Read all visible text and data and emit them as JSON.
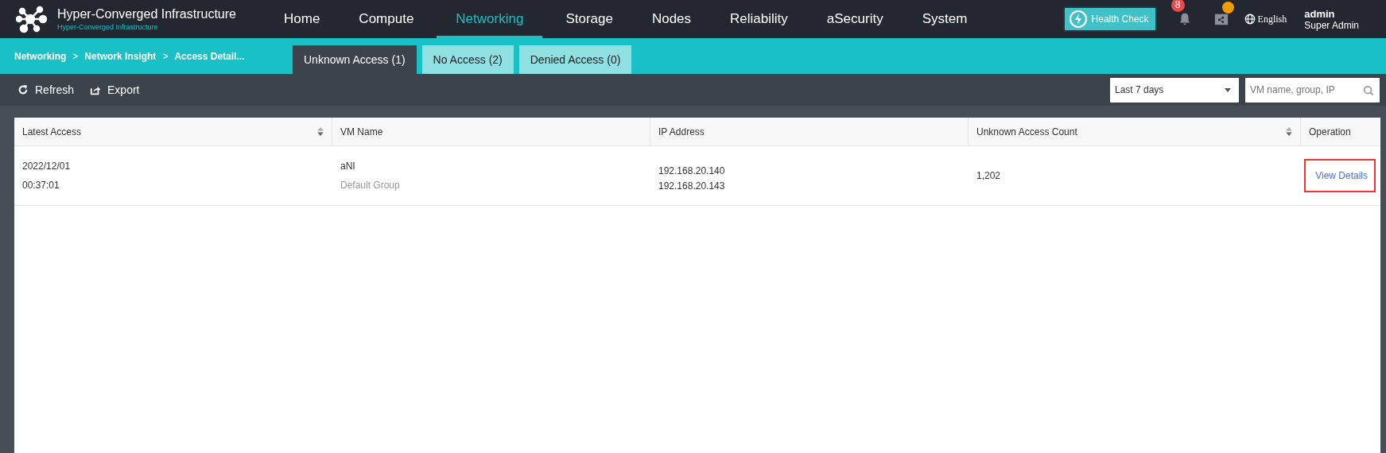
{
  "brand": {
    "title": "Hyper-Converged Infrastructure",
    "subtitle": "Hyper-Converged Infrastructure"
  },
  "nav": [
    {
      "label": "Home",
      "selected": false
    },
    {
      "label": "Compute",
      "selected": false
    },
    {
      "label": "Networking",
      "selected": true
    },
    {
      "label": "Storage",
      "selected": false
    },
    {
      "label": "Nodes",
      "selected": false
    },
    {
      "label": "Reliability",
      "selected": false
    },
    {
      "label": "aSecurity",
      "selected": false
    },
    {
      "label": "System",
      "selected": false
    }
  ],
  "header_right": {
    "health_check": "Health Check",
    "notification_count": "8",
    "language": "English",
    "user": {
      "name": "admin",
      "role": "Super Admin"
    }
  },
  "breadcrumb": [
    "Networking",
    "Network Insight",
    "Access Detail..."
  ],
  "breadcrumb_separator": ">",
  "tabs": [
    {
      "label": "Unknown Access (1)",
      "selected": true
    },
    {
      "label": "No Access (2)",
      "selected": false
    },
    {
      "label": "Denied Access (0)",
      "selected": false
    }
  ],
  "toolbar": {
    "refresh": "Refresh",
    "export": "Export",
    "time_range": "Last 7 days",
    "search": {
      "placeholder": "VM name, group, IP"
    }
  },
  "table": {
    "columns": [
      {
        "label": "Latest Access",
        "sortable": true
      },
      {
        "label": "VM Name",
        "sortable": false
      },
      {
        "label": "IP Address",
        "sortable": false
      },
      {
        "label": "Unknown Access Count",
        "sortable": true
      },
      {
        "label": "Operation",
        "sortable": false
      }
    ],
    "rows": [
      {
        "date": "2022/12/01",
        "time": "00:37:01",
        "vm_name": "aNI",
        "group": "Default Group",
        "ips": [
          "192.168.20.140",
          "192.168.20.143"
        ],
        "count": "1,202",
        "action": "View Details",
        "highlighted": true
      }
    ]
  }
}
